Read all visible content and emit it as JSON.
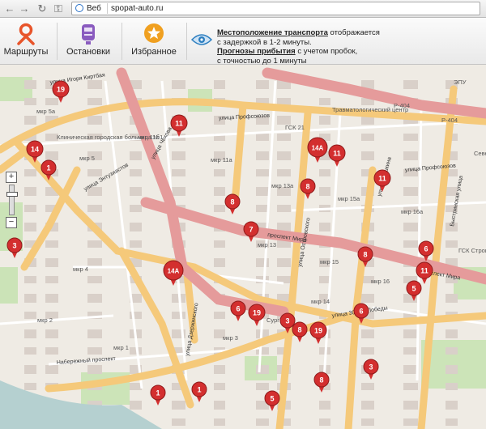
{
  "browser": {
    "back_icon": "←",
    "forward_icon": "→",
    "reload_icon": "↻",
    "key_icon": "⚿",
    "url_prefix": "Веб",
    "url": "spopat-auto.ru"
  },
  "toolbar": {
    "routes_label": "Маршруты",
    "stops_label": "Остановки",
    "favorites_label": "Избранное",
    "info_line1_bold": "Местоположение транспорта",
    "info_line1_rest": " отображается",
    "info_line2": "с задержкой в 1-2 минуты.",
    "info_line3_bold": "Прогнозы прибытия",
    "info_line3_rest": " с учетом пробок,",
    "info_line4": "с точностью до 1 минуты",
    "accent_orange": "#e8552b",
    "accent_purple": "#8a5bbf",
    "accent_star": "#f0a020"
  },
  "map": {
    "zoom_in": "+",
    "zoom_out": "−",
    "marker_color": "#d32f2f",
    "streets": [
      {
        "name": "улица Игоря Киртбая"
      },
      {
        "name": "улица Профсоюзов"
      },
      {
        "name": "улица Профсоюзов"
      },
      {
        "name": "проспект Мира"
      },
      {
        "name": "проспект Мира"
      },
      {
        "name": "улица Энтузиастов"
      },
      {
        "name": "улица Чехова"
      },
      {
        "name": "улица 30 лет Победы"
      },
      {
        "name": "улица Дзержинского"
      },
      {
        "name": "Набережный проспект"
      },
      {
        "name": "улица Пушкина"
      },
      {
        "name": "Быстринская улица"
      },
      {
        "name": "улица Островского"
      }
    ],
    "labels": [
      "мкр 5а",
      "мкр 5",
      "мкр 11б",
      "мкр 11а",
      "мкр 13а",
      "мкр 15а",
      "мкр 16а",
      "мкр 13",
      "мкр 15",
      "мкр 16",
      "мкр 14",
      "мкр 4",
      "мкр 2",
      "мкр 1",
      "мкр 3",
      "ГСК 21",
      "ГСК Строитель",
      "Клиническая городская больница №1",
      "Травматологический центр",
      "Сург",
      "Севе",
      "ЭПУ",
      "Р-404",
      "Р-404"
    ],
    "markers": [
      {
        "label": "19"
      },
      {
        "label": "11"
      },
      {
        "label": "14"
      },
      {
        "label": "1"
      },
      {
        "label": "14А"
      },
      {
        "label": "11"
      },
      {
        "label": "11"
      },
      {
        "label": "8"
      },
      {
        "label": "8"
      },
      {
        "label": "7"
      },
      {
        "label": "3"
      },
      {
        "label": "8"
      },
      {
        "label": "6"
      },
      {
        "label": "11"
      },
      {
        "label": "5"
      },
      {
        "label": "14А"
      },
      {
        "label": "6"
      },
      {
        "label": "19"
      },
      {
        "label": "3"
      },
      {
        "label": "8"
      },
      {
        "label": "19"
      },
      {
        "label": "6"
      },
      {
        "label": "3"
      },
      {
        "label": "8"
      },
      {
        "label": "1"
      },
      {
        "label": "1"
      },
      {
        "label": "5"
      }
    ]
  }
}
